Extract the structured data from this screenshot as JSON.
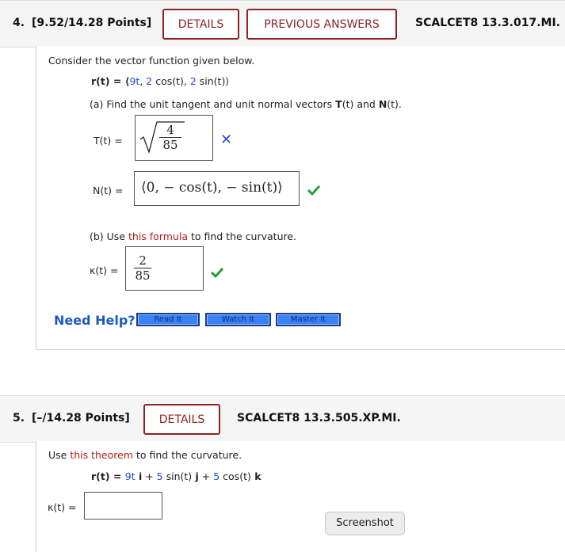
{
  "q4": {
    "number": "4.",
    "points": "[9.52/14.28 Points]",
    "details_label": "DETAILS",
    "prev_answers_label": "PREVIOUS ANSWERS",
    "code": "SCALCET8 13.3.017.MI.",
    "intro": "Consider the vector function given below.",
    "r_func": {
      "lhs": "r(t) = ⟨",
      "c1": "9t",
      "s1": ", ",
      "c2": "2",
      "s2": " cos(t), ",
      "c3": "2",
      "s3": " sin(t)⟩"
    },
    "part_a": {
      "prefix": "(a) Find the unit tangent and unit normal vectors ",
      "T": "T",
      "mid1": "(t) and ",
      "N": "N",
      "end": "(t)."
    },
    "T_label": "T(t)  =",
    "T_answer": {
      "num": "4",
      "den": "85"
    },
    "N_label": "N(t)  =",
    "N_answer": "⟨0, − cos(t), − sin(t)⟩",
    "part_b": {
      "prefix": "(b) Use ",
      "link": "this formula",
      "suffix": " to find the curvature."
    },
    "kappa_label": "κ(t)  =",
    "kappa_answer": {
      "num": "2",
      "den": "85"
    },
    "need_help": "Need Help?",
    "buttons": [
      "Read It",
      "Watch It",
      "Master It"
    ]
  },
  "q5": {
    "number": "5.",
    "points": "[–/14.28 Points]",
    "details_label": "DETAILS",
    "code": "SCALCET8 13.3.505.XP.MI.",
    "intro_prefix": "Use ",
    "intro_link": "this theorem",
    "intro_suffix": " to find the curvature.",
    "r_func": {
      "lhs": "r(t) = ",
      "c1": "9t",
      "i": " i",
      "p1": " + ",
      "c2": "5",
      "s2": " sin(t)",
      "j": " j",
      "p2": " + ",
      "c3": "5",
      "s3": " cos(t)",
      "k": " k"
    },
    "kappa_label": "κ(t)  ="
  },
  "tooltip": "Screenshot",
  "colors": {
    "accent": "#8b2323",
    "blue": "#1d4ed8",
    "link": "#b91c1c",
    "check": "#22a03c"
  }
}
